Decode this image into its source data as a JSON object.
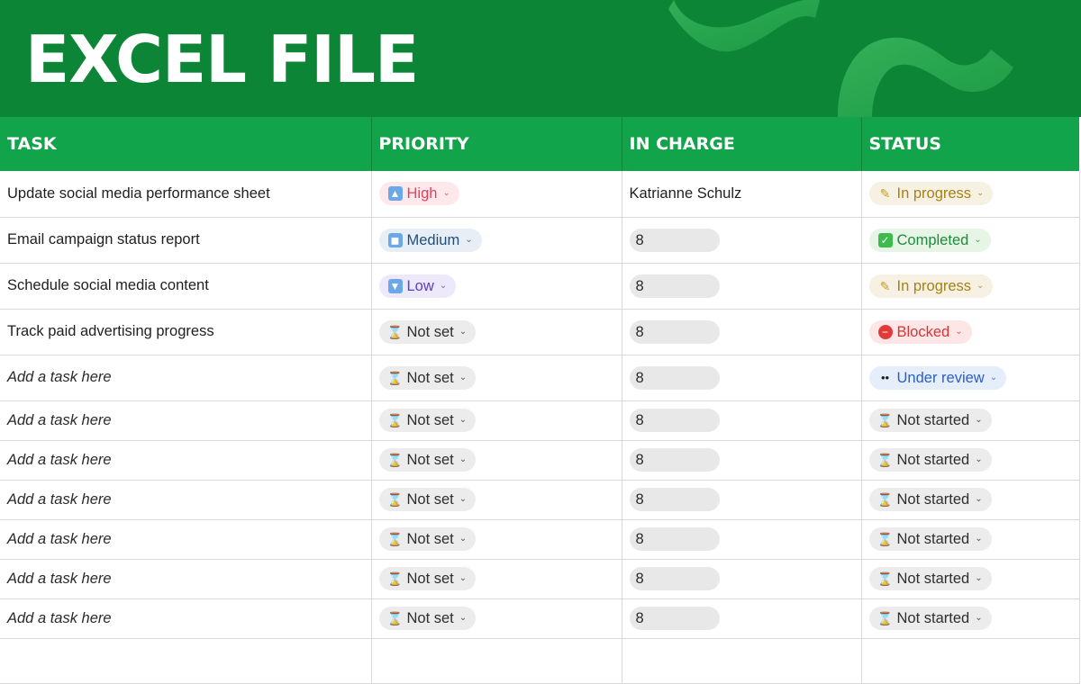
{
  "header": {
    "title": "EXCEL FILE"
  },
  "columns": [
    "TASK",
    "PRIORITY",
    "IN CHARGE",
    "STATUS"
  ],
  "rows": [
    {
      "task": "Update social media performance sheet",
      "placeholder": false,
      "priority": {
        "label": "High",
        "icon": "up-arrow-icon",
        "glyph": "▲",
        "style": "prio-high"
      },
      "in_charge": {
        "type": "name",
        "value": "Katrianne Schulz"
      },
      "status": {
        "label": "In progress",
        "icon": "pencil-icon",
        "glyph": "✎",
        "style": "st-progress"
      }
    },
    {
      "task": "Email campaign status report",
      "placeholder": false,
      "priority": {
        "label": "Medium",
        "icon": "square-icon",
        "glyph": "◼",
        "style": "prio-medium"
      },
      "in_charge": {
        "type": "pill",
        "value": "8"
      },
      "status": {
        "label": "Completed",
        "icon": "checkmark-icon",
        "glyph": "✓",
        "style": "st-completed"
      }
    },
    {
      "task": "Schedule social media content",
      "placeholder": false,
      "priority": {
        "label": "Low",
        "icon": "down-arrow-icon",
        "glyph": "▼",
        "style": "prio-low"
      },
      "in_charge": {
        "type": "pill",
        "value": "8"
      },
      "status": {
        "label": "In progress",
        "icon": "pencil-icon",
        "glyph": "✎",
        "style": "st-progress"
      }
    },
    {
      "task": "Track paid advertising progress",
      "placeholder": false,
      "priority": {
        "label": "Not set",
        "icon": "hourglass-icon",
        "glyph": "⌛",
        "style": "prio-notset"
      },
      "in_charge": {
        "type": "pill",
        "value": "8"
      },
      "status": {
        "label": "Blocked",
        "icon": "no-entry-icon",
        "glyph": "−",
        "style": "st-blocked"
      }
    },
    {
      "task": "Add a task here",
      "placeholder": true,
      "priority": {
        "label": "Not set",
        "icon": "hourglass-icon",
        "glyph": "⌛",
        "style": "prio-notset"
      },
      "in_charge": {
        "type": "pill",
        "value": "8"
      },
      "status": {
        "label": "Under review",
        "icon": "eyes-icon",
        "glyph": "••",
        "style": "st-review"
      }
    },
    {
      "task": "Add a task here",
      "placeholder": true,
      "priority": {
        "label": "Not set",
        "icon": "hourglass-icon",
        "glyph": "⌛",
        "style": "prio-notset"
      },
      "in_charge": {
        "type": "pill",
        "value": "8"
      },
      "status": {
        "label": "Not started",
        "icon": "hourglass-icon",
        "glyph": "⌛",
        "style": "st-notstarted"
      }
    },
    {
      "task": "Add a task here",
      "placeholder": true,
      "priority": {
        "label": "Not set",
        "icon": "hourglass-icon",
        "glyph": "⌛",
        "style": "prio-notset"
      },
      "in_charge": {
        "type": "pill",
        "value": "8"
      },
      "status": {
        "label": "Not started",
        "icon": "hourglass-icon",
        "glyph": "⌛",
        "style": "st-notstarted"
      }
    },
    {
      "task": "Add a task here",
      "placeholder": true,
      "priority": {
        "label": "Not set",
        "icon": "hourglass-icon",
        "glyph": "⌛",
        "style": "prio-notset"
      },
      "in_charge": {
        "type": "pill",
        "value": "8"
      },
      "status": {
        "label": "Not started",
        "icon": "hourglass-icon",
        "glyph": "⌛",
        "style": "st-notstarted"
      }
    },
    {
      "task": "Add a task here",
      "placeholder": true,
      "priority": {
        "label": "Not set",
        "icon": "hourglass-icon",
        "glyph": "⌛",
        "style": "prio-notset"
      },
      "in_charge": {
        "type": "pill",
        "value": "8"
      },
      "status": {
        "label": "Not started",
        "icon": "hourglass-icon",
        "glyph": "⌛",
        "style": "st-notstarted"
      }
    },
    {
      "task": "Add a task here",
      "placeholder": true,
      "priority": {
        "label": "Not set",
        "icon": "hourglass-icon",
        "glyph": "⌛",
        "style": "prio-notset"
      },
      "in_charge": {
        "type": "pill",
        "value": "8"
      },
      "status": {
        "label": "Not started",
        "icon": "hourglass-icon",
        "glyph": "⌛",
        "style": "st-notstarted"
      }
    },
    {
      "task": "Add a task here",
      "placeholder": true,
      "priority": {
        "label": "Not set",
        "icon": "hourglass-icon",
        "glyph": "⌛",
        "style": "prio-notset"
      },
      "in_charge": {
        "type": "pill",
        "value": "8"
      },
      "status": {
        "label": "Not started",
        "icon": "hourglass-icon",
        "glyph": "⌛",
        "style": "st-notstarted"
      }
    }
  ],
  "dropdown_caret": "⌄",
  "colors": {
    "banner": "#0c8636",
    "header_row": "#12a44a",
    "grid_line": "#d9d9d9"
  }
}
